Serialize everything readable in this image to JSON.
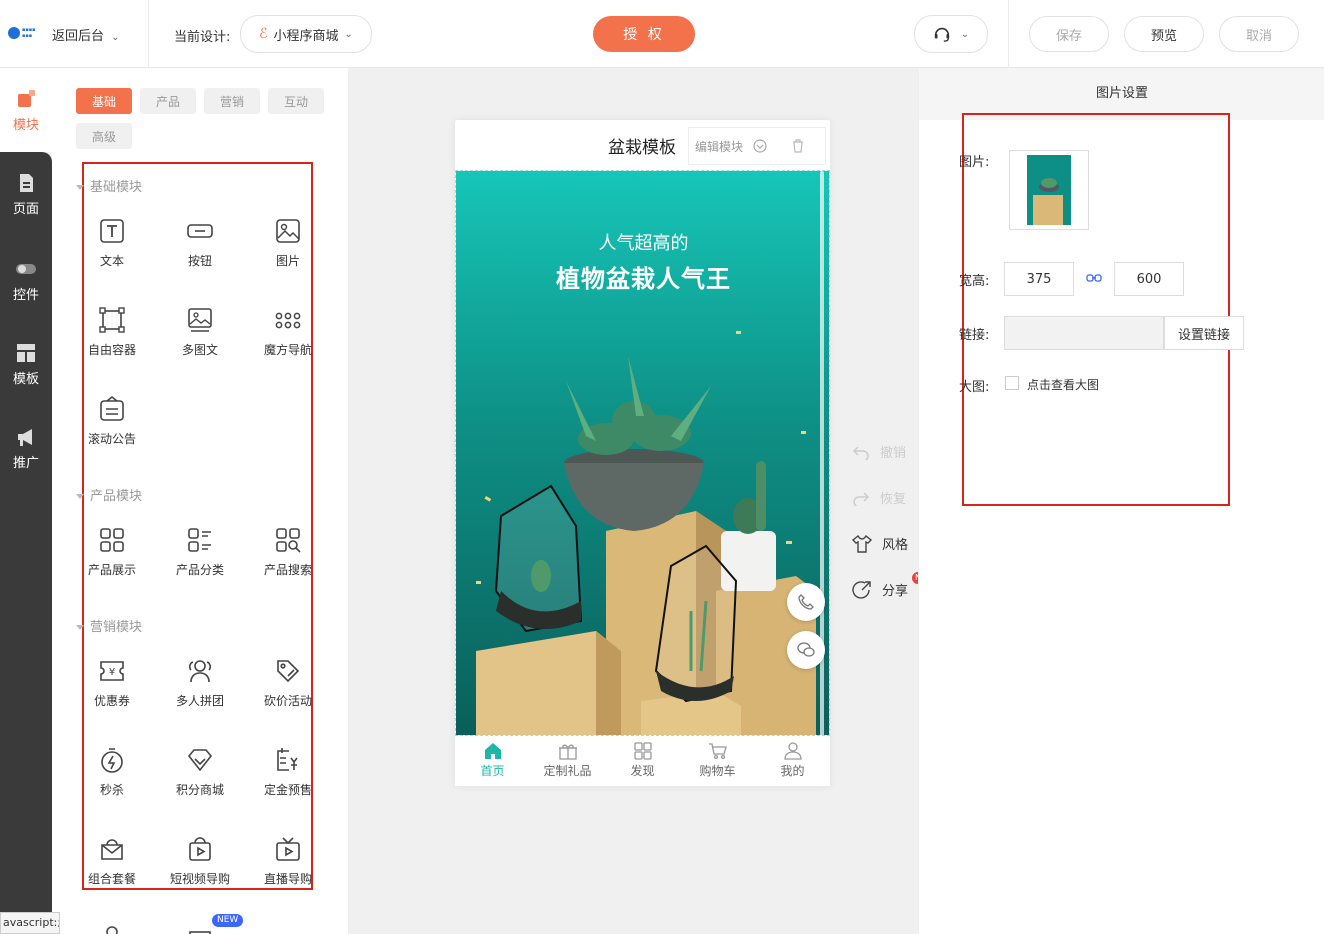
{
  "topbar": {
    "back_label": "返回后台",
    "current_design_label": "当前设计:",
    "design_name": "小程序商城",
    "auth_label": "授 权",
    "save_label": "保存",
    "preview_label": "预览",
    "cancel_label": "取消"
  },
  "leftnav": [
    {
      "label": "模块",
      "icon": "module-icon",
      "active": true
    },
    {
      "label": "页面",
      "icon": "page-icon"
    },
    {
      "label": "控件",
      "icon": "toggle-icon"
    },
    {
      "label": "模板",
      "icon": "template-icon"
    },
    {
      "label": "推广",
      "icon": "megaphone-icon"
    }
  ],
  "module_tabs": [
    "基础",
    "产品",
    "营销",
    "互动",
    "高级"
  ],
  "sections": {
    "basic": "基础模块",
    "product": "产品模块",
    "marketing": "营销模块"
  },
  "modules": {
    "basic": [
      "文本",
      "按钮",
      "图片",
      "自由容器",
      "多图文",
      "魔方导航",
      "滚动公告"
    ],
    "product": [
      "产品展示",
      "产品分类",
      "产品搜索"
    ],
    "marketing": [
      "优惠券",
      "多人拼团",
      "砍价活动",
      "秒杀",
      "积分商城",
      "定金预售",
      "组合套餐",
      "短视频导购",
      "直播导购"
    ]
  },
  "new_badge": "NEW",
  "status_tooltip": "avascript:;",
  "phone": {
    "title": "盆栽模板",
    "edit_module": "编辑模块",
    "banner_line1": "人气超高的",
    "banner_line2": "植物盆栽人气王",
    "tabbar": [
      "首页",
      "定制礼品",
      "发现",
      "购物车",
      "我的"
    ]
  },
  "side_tools": {
    "undo": "撤销",
    "redo": "恢复",
    "style": "风格",
    "share": "分享",
    "share_badge": "N"
  },
  "settings": {
    "header": "图片设置",
    "image_label": "图片:",
    "size_label": "宽高:",
    "width": "375",
    "height": "600",
    "link_label": "链接:",
    "set_link": "设置链接",
    "bigimg_label": "大图:",
    "bigimg_text": "点击查看大图"
  },
  "colors": {
    "accent": "#f3714b",
    "teal": "#1eb6a8",
    "highlight_box": "#d9241c"
  }
}
